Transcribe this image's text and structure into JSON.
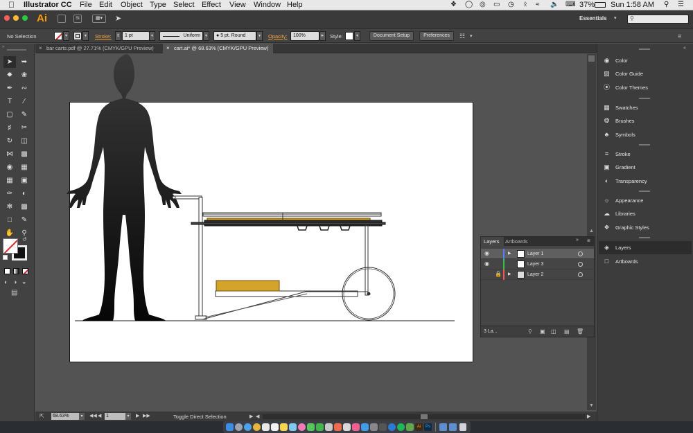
{
  "menubar": {
    "app_name": "Illustrator CC",
    "menus": [
      "File",
      "Edit",
      "Object",
      "Type",
      "Select",
      "Effect",
      "View",
      "Window",
      "Help"
    ],
    "battery": "37%",
    "clock": "Sun 1:58 AM"
  },
  "appbar": {
    "logo": "Ai",
    "workspace": "Essentials",
    "search_placeholder": ""
  },
  "control_bar": {
    "selection_label": "No Selection",
    "stroke_label": "Stroke:",
    "stroke_value": "1 pt",
    "profile_value": "Uniform",
    "brush_value": "5 pt. Round",
    "opacity_label": "Opacity:",
    "opacity_value": "100%",
    "style_label": "Style:",
    "document_setup_label": "Document Setup",
    "preferences_label": "Preferences"
  },
  "tabs": [
    {
      "label": "bar carts.pdf @ 27.71% (CMYK/GPU Preview)",
      "active": false
    },
    {
      "label": "cart.ai* @ 68.63% (CMYK/GPU Preview)",
      "active": true
    }
  ],
  "status_bar": {
    "zoom": "68.63%",
    "artboard": "1",
    "status_text": "Toggle Direct Selection"
  },
  "right_panel": {
    "groups": [
      [
        "Color",
        "Color Guide",
        "Color Themes"
      ],
      [
        "Swatches",
        "Brushes",
        "Symbols"
      ],
      [
        "Stroke",
        "Gradient",
        "Transparency"
      ],
      [
        "Appearance",
        "Libraries",
        "Graphic Styles"
      ],
      [
        "Layers",
        "Artboards"
      ]
    ],
    "selected": "Layers"
  },
  "layers_panel": {
    "tabs": [
      "Layers",
      "Artboards"
    ],
    "layers": [
      {
        "name": "Layer 1",
        "color": "#4f7fff",
        "visible": true,
        "locked": false,
        "selected": true
      },
      {
        "name": "Layer 3",
        "color": "#29c943",
        "visible": true,
        "locked": false,
        "selected": false
      },
      {
        "name": "Layer 2",
        "color": "#ff4f4f",
        "visible": false,
        "locked": true,
        "selected": false
      }
    ],
    "footer_count": "3 La..."
  },
  "colors": {
    "accent_gold": "#d4a32a",
    "canvas_bg": "#535353",
    "artboard": "#ffffff"
  }
}
